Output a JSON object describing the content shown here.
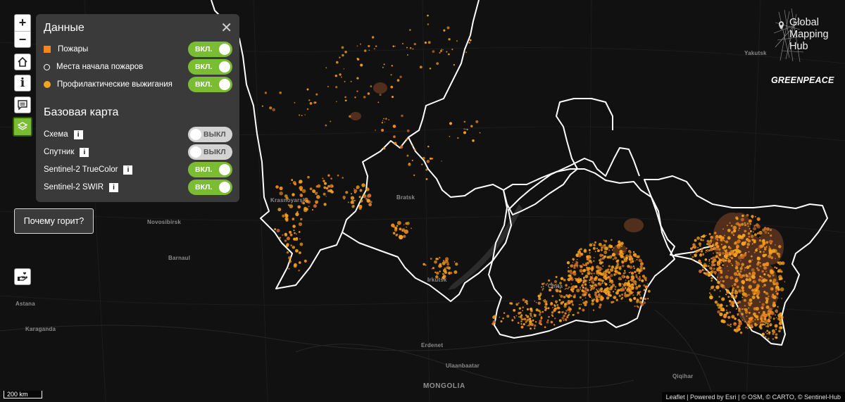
{
  "map": {
    "cities": [
      {
        "name": "Yakutsk"
      },
      {
        "name": "Krasnoyarsk"
      },
      {
        "name": "Bratsk"
      },
      {
        "name": "Novosibirsk"
      },
      {
        "name": "Barnaul"
      },
      {
        "name": "Irkutsk"
      },
      {
        "name": "Chita"
      },
      {
        "name": "Astana"
      },
      {
        "name": "Karaganda"
      },
      {
        "name": "Erdenet"
      },
      {
        "name": "Ulaanbaatar"
      },
      {
        "name": "Qiqihar"
      }
    ],
    "country_label": "MONGOLIA",
    "colors": {
      "fire": "#f28c1c",
      "burn": "#f5a31d",
      "burned_area": "#5e3520",
      "boundary": "#ffffff",
      "lake": "#2b2b2b"
    }
  },
  "controls": {
    "zoom_in": "+",
    "zoom_out": "−",
    "home_icon": "home-icon",
    "info_icon_label": "i",
    "comment_icon": "comment-icon",
    "layers_icon": "layers-icon"
  },
  "panel": {
    "data_title": "Данные",
    "close_label": "✕",
    "data_layers": [
      {
        "label": "Пожары",
        "marker": "orange-square",
        "toggle": "ВКЛ."
      },
      {
        "label": "Места начала пожаров",
        "marker": "hollow-circle",
        "toggle": "ВКЛ."
      },
      {
        "label": "Профилактические выжигания",
        "marker": "orange-circle",
        "toggle": "ВКЛ."
      }
    ],
    "basemap_title": "Базовая карта",
    "basemaps": [
      {
        "label": "Схема",
        "info": "i",
        "toggle": "ВЫКЛ",
        "on": false
      },
      {
        "label": "Спутник",
        "info": "i",
        "toggle": "ВЫКЛ",
        "on": false
      },
      {
        "label": "Sentinel-2 TrueColor",
        "info": "i",
        "toggle": "ВКЛ.",
        "on": true
      },
      {
        "label": "Sentinel-2 SWIR",
        "info": "i",
        "toggle": "ВКЛ.",
        "on": true
      }
    ]
  },
  "why_button": "Почему горит?",
  "donate_icon": "hand-heart-icon",
  "logos": {
    "gmh_lines": [
      "Global",
      "Mapping",
      "Hub"
    ],
    "greenpeace": "GREENPEACE"
  },
  "scale": "200 km",
  "attribution": "Leaflet | Powered by Esri | © OSM, © CARTO, © Sentinel-Hub"
}
